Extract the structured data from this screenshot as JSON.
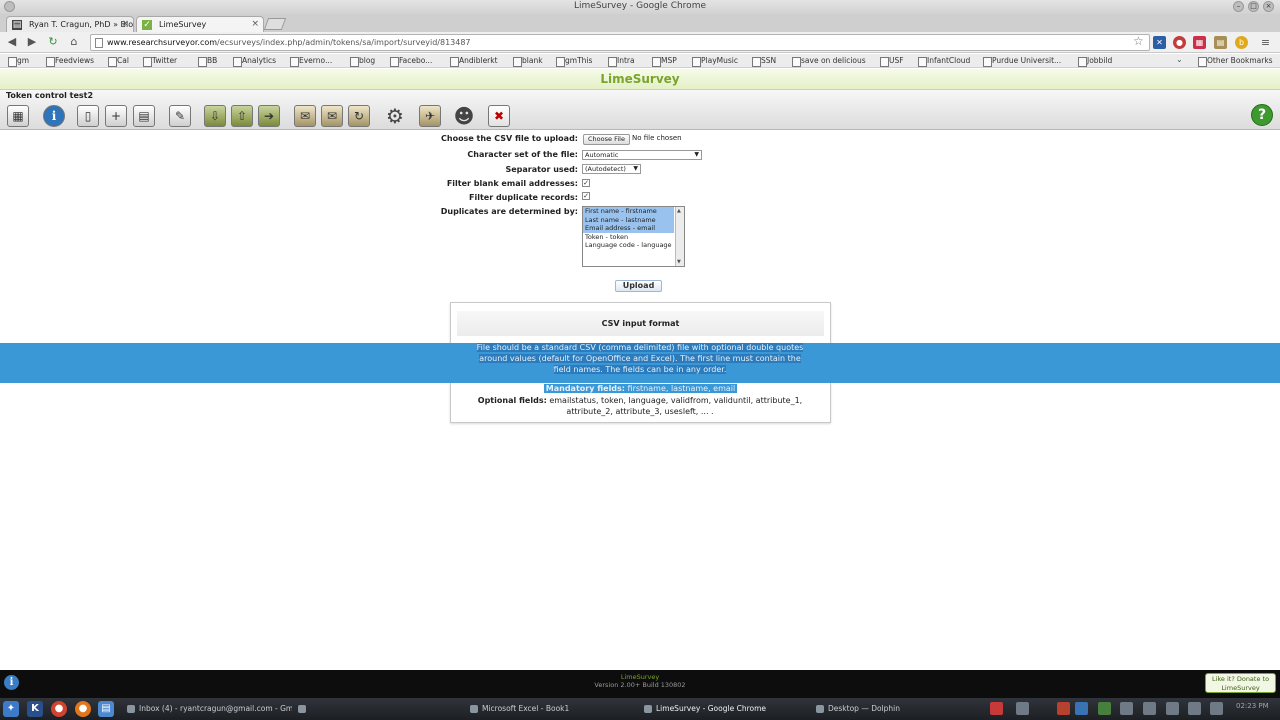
{
  "window": {
    "title": "LimeSurvey - Google Chrome"
  },
  "tabs": [
    {
      "label": "Ryan T. Cragun, PhD » Blo"
    },
    {
      "label": "LimeSurvey"
    }
  ],
  "address": {
    "domain": "www.researchsurveyor.com",
    "path": "/ecsurveys/index.php/admin/tokens/sa/import/surveyid/813487"
  },
  "bookmarks": [
    "gm",
    "Feedviews",
    "Cal",
    "Twitter",
    "BB",
    "Analytics",
    "Evernо...",
    "blog",
    "Facebo...",
    "Andiblerkt",
    "blank",
    "gmThis",
    "Intra",
    "MSP",
    "PlayMusic",
    "SSN",
    "save on delicious",
    "USF",
    "InfantCloud",
    "Purdue Universit...",
    "Jobbild",
    "Other Bookmarks"
  ],
  "app": {
    "name": "LimeSurvey"
  },
  "survey": {
    "title": "Token control test2"
  },
  "form": {
    "csv_file_label": "Choose the CSV file to upload:",
    "choose_file_button": "Choose File",
    "no_file_text": "No file chosen",
    "charset_label": "Character set of the file:",
    "charset_value": "Automatic",
    "separator_label": "Separator used:",
    "separator_value": "(Autodetect)",
    "filter_blank_label": "Filter blank email addresses:",
    "filter_blank_checked": true,
    "filter_dup_label": "Filter duplicate records:",
    "filter_dup_checked": true,
    "duplicates_label": "Duplicates are determined by:",
    "duplicate_options": [
      {
        "label": "First name - firstname",
        "selected": true
      },
      {
        "label": "Last name - lastname",
        "selected": true
      },
      {
        "label": "Email address - email",
        "selected": true
      },
      {
        "label": "Token - token",
        "selected": false
      },
      {
        "label": "Language code - language",
        "selected": false
      }
    ],
    "upload_button": "Upload"
  },
  "csv_info": {
    "heading": "CSV input format",
    "description_line1": "File should be a standard CSV (comma delimited) file with optional double quotes",
    "description_line2": "around values (default for OpenOffice and Excel). The first line must contain the",
    "description_line3": "field names. The fields can be in any order.",
    "mandatory_label": "Mandatory fields:",
    "mandatory_fields": "firstname, lastname, email",
    "optional_label": "Optional fields:",
    "optional_fields_line1": "emailstatus, token, language, validfrom, validuntil, attribute_1,",
    "optional_fields_line2": "attribute_2, attribute_3, usesleft, ... ."
  },
  "footer": {
    "name": "LimeSurvey",
    "version": "Version 2.00+ Build 130802",
    "donate": "Like it? Donate to LimeSurvey"
  },
  "taskbar": {
    "tasks": [
      "Inbox (4) - ryantcragun@gmail.com - Gm",
      "",
      "Microsoft Excel - Book1",
      "LimeSurvey - Google Chrome",
      "Desktop — Dolphin"
    ],
    "clock": "02:23 PM"
  },
  "colors": {
    "selection": "#3a98d6",
    "lime": "#7aa42c",
    "help": "#3e9a2f"
  }
}
